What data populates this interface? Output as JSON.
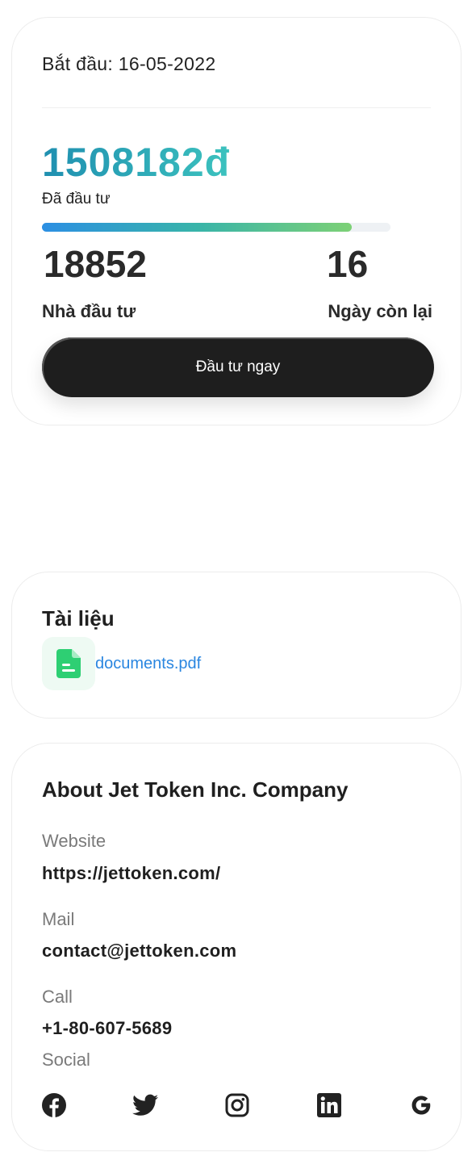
{
  "invest": {
    "start_date": "Bắt đầu: 16-05-2022",
    "amount": "1508182đ",
    "amount_label": "Đã đầu tư",
    "progress": 0.89,
    "investors_count": "18852",
    "investors_label": "Nhà đầu tư",
    "days_left": "16",
    "days_left_label": "Ngày còn lại",
    "invest_button": "Đầu tư ngay"
  },
  "documents": {
    "title": "Tài liệu",
    "file_name": "documents.pdf",
    "file_icon": "file-document-icon"
  },
  "about": {
    "title": "About Jet Token Inc. Company",
    "website_label": "Website",
    "website_value": "https://jettoken.com/",
    "mail_label": "Mail",
    "mail_value": "contact@jettoken.com",
    "call_label": "Call",
    "call_value": "+1-80-607-5689",
    "social_label": "Social",
    "social_icons": [
      "facebook-icon",
      "twitter-icon",
      "instagram-icon",
      "linkedin-icon",
      "google-icon"
    ]
  },
  "colors": {
    "accent_teal": "#27a3b8",
    "link_blue": "#2a86e0",
    "button_dark": "#1e1e1e",
    "file_green": "#2ecf73"
  }
}
